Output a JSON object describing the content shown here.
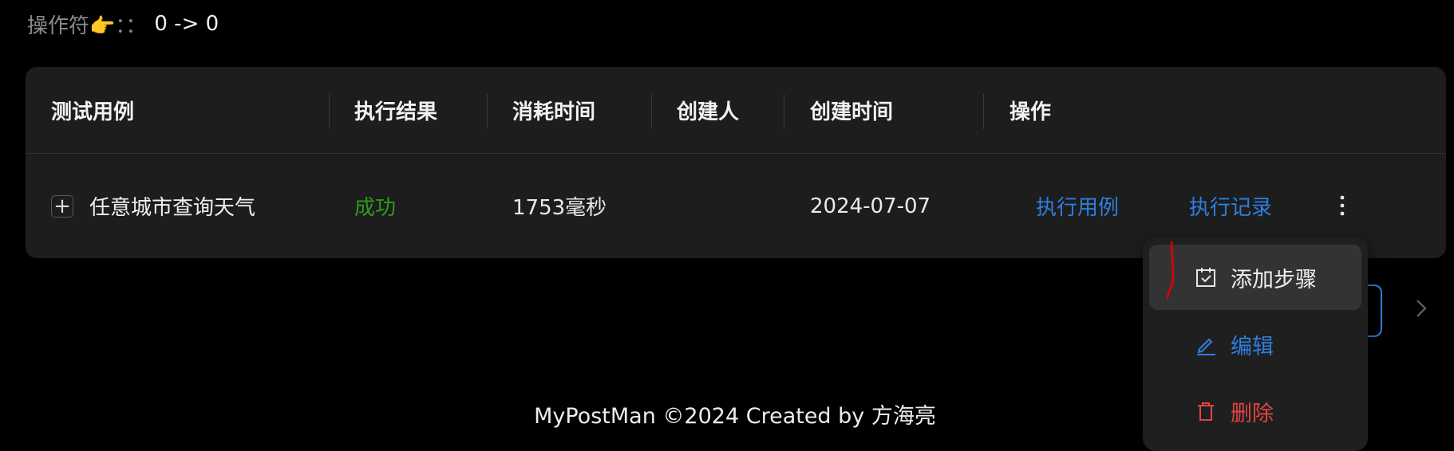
{
  "operator": {
    "label": "操作符👉：：",
    "value": "0 -> 0"
  },
  "table": {
    "columns": [
      "测试用例",
      "执行结果",
      "消耗时间",
      "创建人",
      "创建时间",
      "操作"
    ],
    "rows": [
      {
        "expand_symbol": "+",
        "case_name": "任意城市查询天气",
        "result": "成功",
        "duration": "1753毫秒",
        "creator": "",
        "created_at": "2024-07-07",
        "actions": {
          "run": "执行用例",
          "records": "执行记录"
        }
      }
    ]
  },
  "dropdown": {
    "items": [
      {
        "label": "添加步骤",
        "icon": "calendar-check-icon"
      },
      {
        "label": "编辑",
        "icon": "pencil-icon"
      },
      {
        "label": "删除",
        "icon": "trash-icon"
      }
    ]
  },
  "footer": {
    "text": "MyPostMan ©2024 Created by 方海亮"
  },
  "colors": {
    "background": "#000000",
    "card": "#1d1d1d",
    "link": "#2d7fe0",
    "success": "#2f9a1a",
    "danger": "#e04545"
  }
}
